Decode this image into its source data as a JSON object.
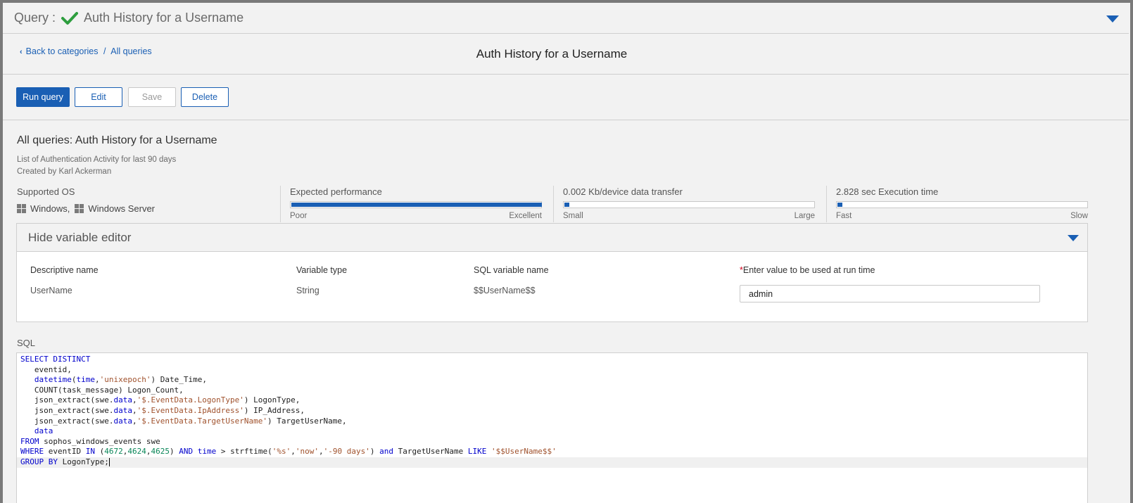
{
  "header": {
    "query_label": "Query :",
    "title": "Auth History for a Username"
  },
  "breadcrumb": {
    "back_label": "Back to categories",
    "separator": "/",
    "all_label": "All queries",
    "page_title": "Auth History for a Username"
  },
  "toolbar": {
    "run_label": "Run query",
    "edit_label": "Edit",
    "save_label": "Save",
    "delete_label": "Delete"
  },
  "details": {
    "heading": "All queries: Auth History for a Username",
    "description": "List of Authentication Activity for last 90 days",
    "created_by": "Created by Karl Ackerman",
    "supported_os_label": "Supported OS",
    "os": [
      "Windows,",
      "Windows Server"
    ],
    "performance": {
      "label": "Expected performance",
      "level": 1.0,
      "low": "Poor",
      "high": "Excellent"
    },
    "transfer": {
      "label": "0.002 Kb/device data transfer",
      "level": 0.02,
      "low": "Small",
      "high": "Large"
    },
    "execution": {
      "label": "2.828 sec Execution time",
      "level": 0.02,
      "low": "Fast",
      "high": "Slow"
    }
  },
  "variable_editor": {
    "toggle_label": "Hide variable editor",
    "columns": {
      "name": "Descriptive name",
      "type": "Variable type",
      "sql_name": "SQL variable name",
      "value_required": "*",
      "value": "Enter value to be used at run time"
    },
    "row": {
      "name": "UserName",
      "type": "String",
      "sql_name": "$$UserName$$",
      "value": "admin"
    }
  },
  "sql": {
    "label": "SQL",
    "lines": [
      "SELECT DISTINCT",
      "   eventid,",
      "   datetime(time,'unixepoch') Date_Time,",
      "   COUNT(task_message) Logon_Count,",
      "   json_extract(swe.data,'$.EventData.LogonType') LogonType,",
      "   json_extract(swe.data,'$.EventData.IpAddress') IP_Address,",
      "   json_extract(swe.data,'$.EventData.TargetUserName') TargetUserName,",
      "   data",
      "FROM sophos_windows_events swe",
      "WHERE eventID IN (4672,4624,4625) AND time > strftime('%s','now','-90 days') and TargetUserName LIKE '$$UserName$$'",
      "GROUP BY LogonType;"
    ]
  },
  "colors": {
    "accent": "#1a5fb4",
    "check": "#2e9e3f",
    "required": "#d0021b"
  }
}
